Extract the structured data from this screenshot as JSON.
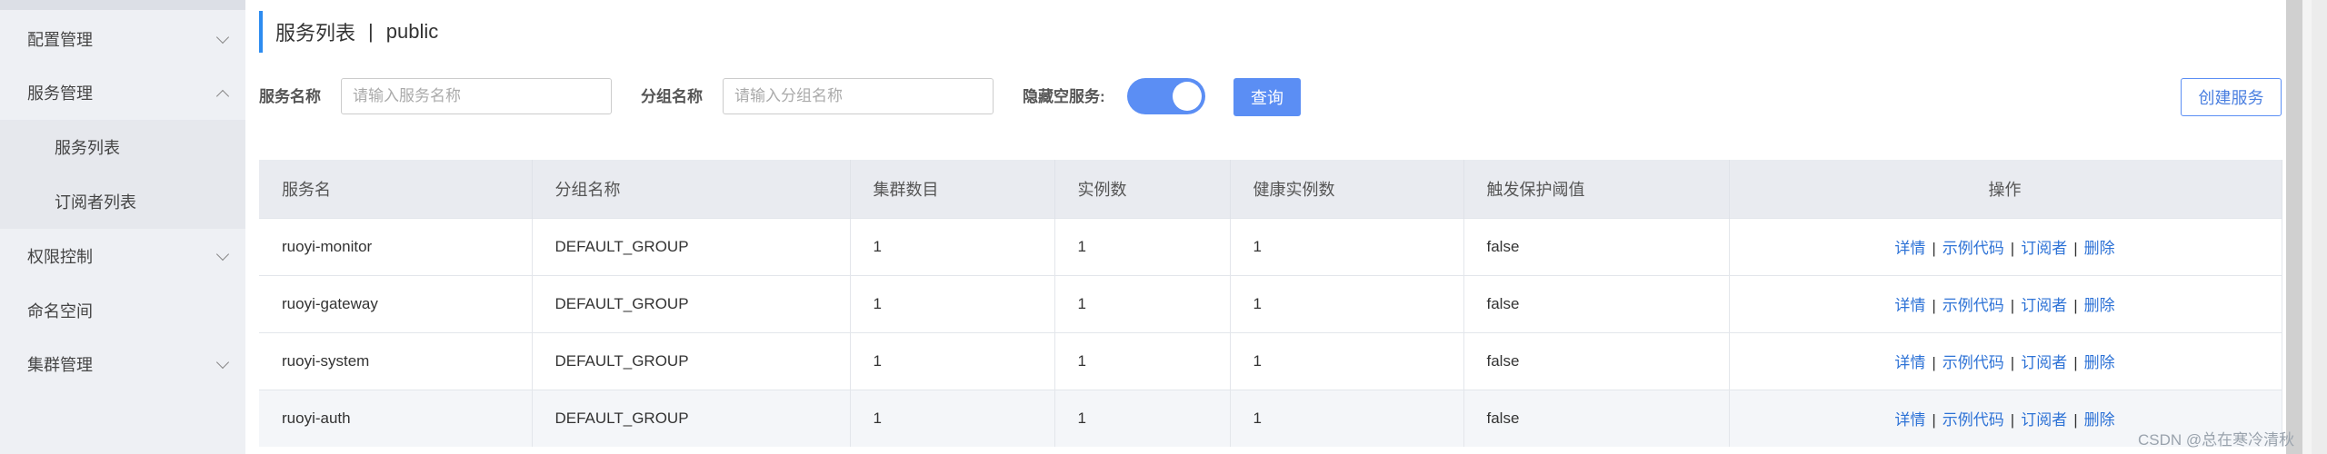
{
  "sidebar": {
    "items": [
      {
        "label": "配置管理",
        "chevron": "down"
      },
      {
        "label": "服务管理",
        "chevron": "up"
      },
      {
        "label": "服务列表",
        "sub": true
      },
      {
        "label": "订阅者列表",
        "sub": true
      },
      {
        "label": "权限控制",
        "chevron": "down"
      },
      {
        "label": "命名空间"
      },
      {
        "label": "集群管理",
        "chevron": "down"
      }
    ]
  },
  "header": {
    "title": "服务列表",
    "separator": "|",
    "namespace": "public"
  },
  "filters": {
    "service_name_label": "服务名称",
    "service_name_placeholder": "请输入服务名称",
    "group_name_label": "分组名称",
    "group_name_placeholder": "请输入分组名称",
    "hide_empty_label": "隐藏空服务:",
    "hide_empty_on": true,
    "query_button": "查询",
    "create_button": "创建服务"
  },
  "table": {
    "columns": [
      "服务名",
      "分组名称",
      "集群数目",
      "实例数",
      "健康实例数",
      "触发保护阈值",
      "操作"
    ],
    "rows": [
      [
        "ruoyi-monitor",
        "DEFAULT_GROUP",
        "1",
        "1",
        "1",
        "false"
      ],
      [
        "ruoyi-gateway",
        "DEFAULT_GROUP",
        "1",
        "1",
        "1",
        "false"
      ],
      [
        "ruoyi-system",
        "DEFAULT_GROUP",
        "1",
        "1",
        "1",
        "false"
      ],
      [
        "ruoyi-auth",
        "DEFAULT_GROUP",
        "1",
        "1",
        "1",
        "false"
      ]
    ],
    "actions": [
      "详情",
      "示例代码",
      "订阅者",
      "删除"
    ],
    "action_separator": "|"
  },
  "watermark": "CSDN @总在寒冷清秋",
  "colors": {
    "accent": "#5b8ef4",
    "link": "#2d72d6",
    "sidebar_bg": "#eef0f4"
  }
}
